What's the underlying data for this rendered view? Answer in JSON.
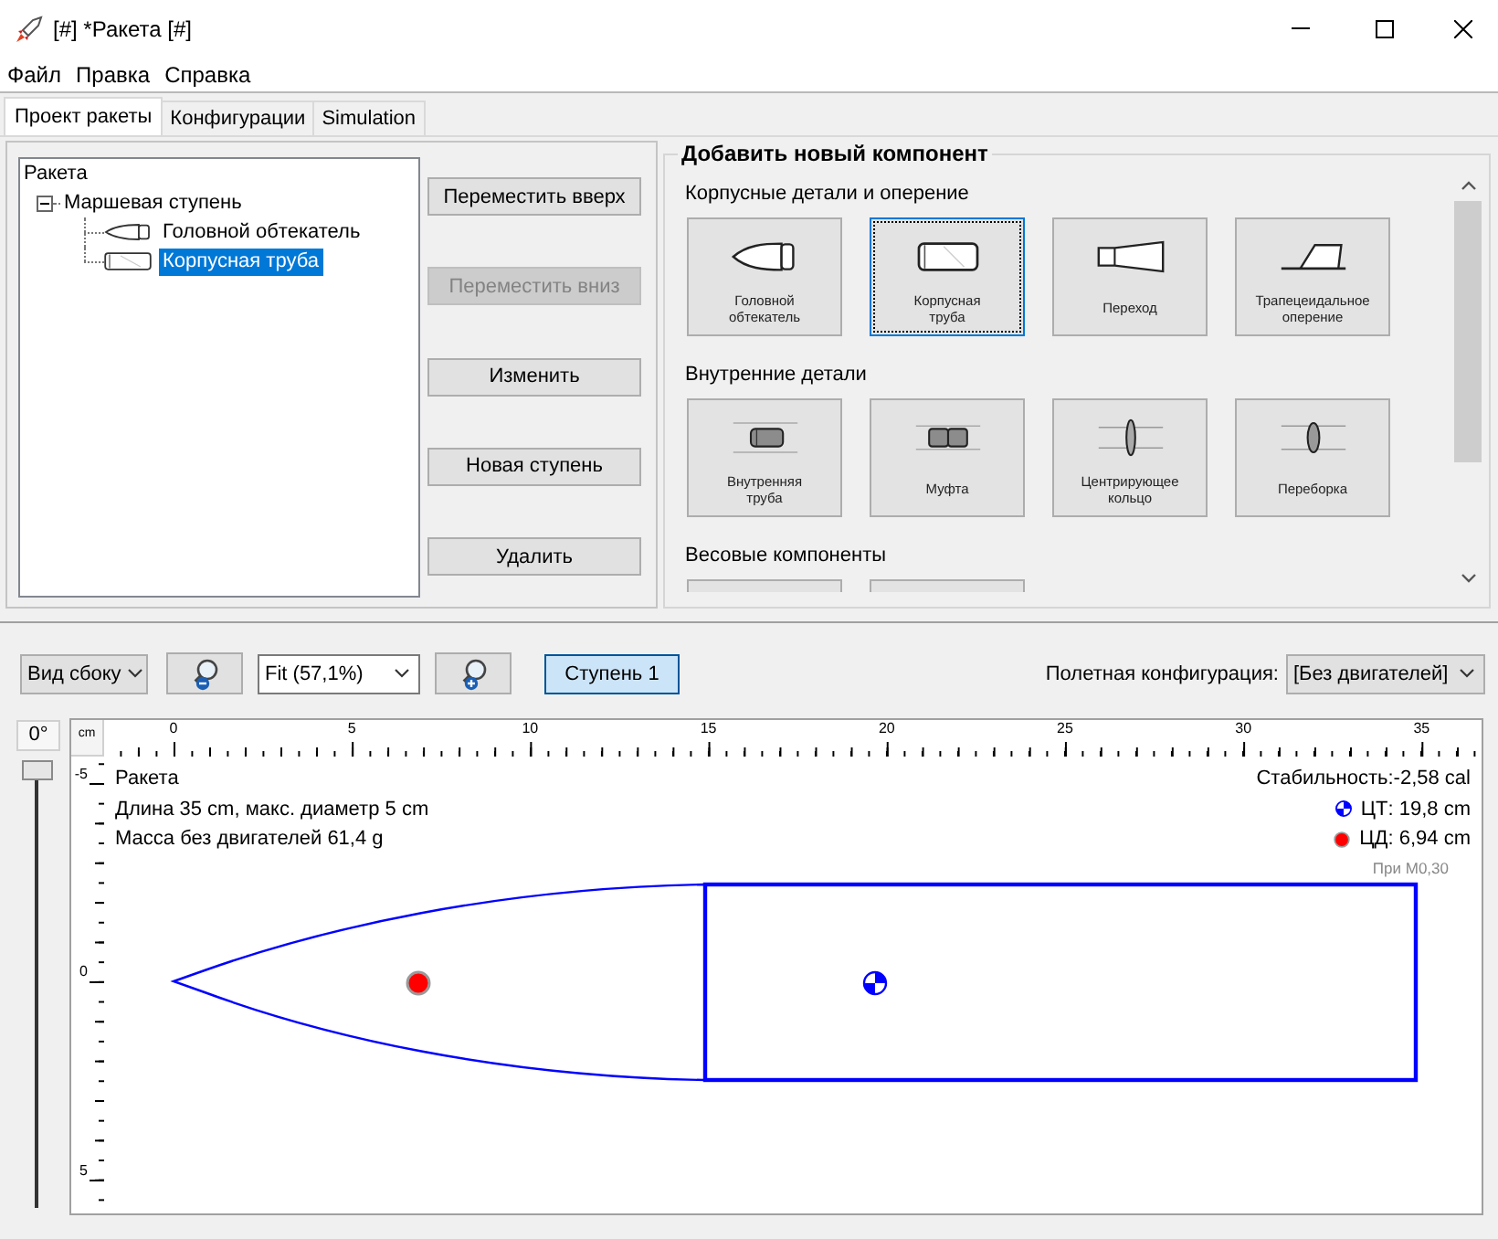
{
  "window": {
    "title": "[#] *Ракета [#]"
  },
  "menu": [
    "Файл",
    "Правка",
    "Справка"
  ],
  "tabs": [
    {
      "label": "Проект ракеты",
      "selected": true
    },
    {
      "label": "Конфигурации",
      "selected": false
    },
    {
      "label": "Simulation",
      "selected": false
    }
  ],
  "component_tree": {
    "items": [
      {
        "label": "Ракета",
        "selected": false,
        "children": [
          {
            "label": "Маршевая ступень",
            "expanded": true,
            "selected": false,
            "children": [
              {
                "label": "Головной обтекатель",
                "kind": "nosecone",
                "selected": false
              },
              {
                "label": "Корпусная труба",
                "kind": "bodytube",
                "selected": true
              }
            ]
          }
        ]
      }
    ]
  },
  "tree_buttons": [
    {
      "label": "Переместить вверх",
      "disabled": false
    },
    {
      "label": "Переместить вниз",
      "disabled": true
    },
    {
      "label": "Изменить",
      "disabled": false
    },
    {
      "label": "Новая ступень",
      "disabled": false
    },
    {
      "label": "Удалить",
      "disabled": false
    }
  ],
  "add_component": {
    "title": "Добавить новый компонент",
    "sections": [
      {
        "title": "Корпусные детали и оперение",
        "items": [
          {
            "label": "Головной обтекатель",
            "kind": "nosecone",
            "focused": false
          },
          {
            "label": "Корпусная труба",
            "kind": "bodytube",
            "focused": true
          },
          {
            "label": "Переход",
            "kind": "transition",
            "focused": false
          },
          {
            "label": "Трапецеидальное оперение",
            "kind": "finset",
            "focused": false
          }
        ]
      },
      {
        "title": "Внутренние детали",
        "items": [
          {
            "label": "Внутренняя труба",
            "kind": "innertube",
            "focused": false
          },
          {
            "label": "Муфта",
            "kind": "coupler",
            "focused": false
          },
          {
            "label": "Центрирующее кольцо",
            "kind": "centeringring",
            "focused": false
          },
          {
            "label": "Переборка",
            "kind": "bulkhead",
            "focused": false
          }
        ]
      },
      {
        "title": "Весовые компоненты",
        "items": [
          {
            "kind": "cut_off"
          },
          {
            "kind": "cut_off"
          }
        ]
      }
    ]
  },
  "view_toolbar": {
    "view_select": {
      "value": "Вид сбоку"
    },
    "zoom_select": {
      "value": "Fit (57,1%)"
    },
    "stage_buttons": [
      {
        "label": "Ступень 1",
        "selected": true
      }
    ],
    "flight_config": {
      "label": "Полетная конфигурация:",
      "value": "[Без двигателей]"
    }
  },
  "rocket_view": {
    "rotation": {
      "label": "0°",
      "level": 0
    },
    "ruler": {
      "unit": "cm",
      "x_labels": [
        "0",
        "5",
        "10",
        "15",
        "20",
        "25",
        "30",
        "35"
      ],
      "y_labels": [
        "-5",
        "0",
        "5"
      ]
    },
    "info": [
      "Ракета",
      "Длина 35 cm, макс. диаметр 5 cm",
      "Масса без двигателей 61,4 g"
    ],
    "stability": "Стабильность:-2,58 cal",
    "markers": [
      {
        "kind": "cg",
        "label": "ЦТ: 19,8 cm"
      },
      {
        "kind": "cp",
        "label": "ЦД: 6,94 cm"
      }
    ],
    "mach_note": "При M0,30"
  }
}
